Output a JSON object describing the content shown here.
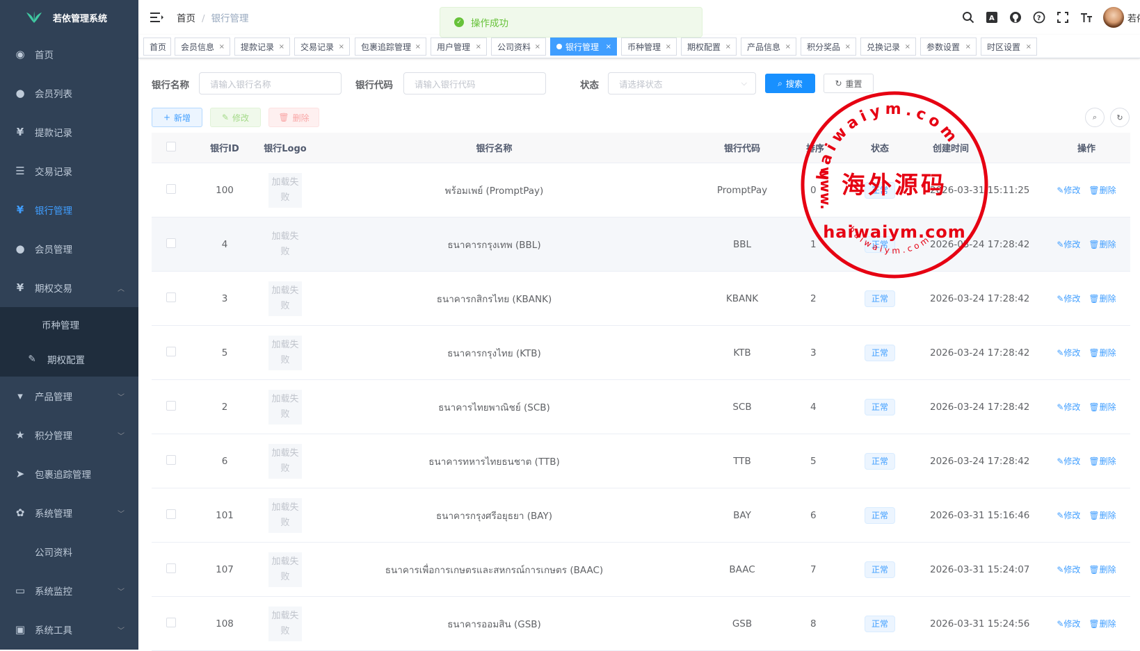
{
  "app": {
    "title": "若依管理系统"
  },
  "sidebar": {
    "items": [
      {
        "label": "首页",
        "icon": "dashboard-icon",
        "glyph": "◉"
      },
      {
        "label": "会员列表",
        "icon": "user-icon",
        "glyph": "●"
      },
      {
        "label": "提款记录",
        "icon": "yen-icon",
        "glyph": "¥"
      },
      {
        "label": "交易记录",
        "icon": "list-icon",
        "glyph": "☰"
      },
      {
        "label": "银行管理",
        "icon": "yen-icon",
        "glyph": "¥",
        "active": true
      },
      {
        "label": "会员管理",
        "icon": "peoples-icon",
        "glyph": "●"
      },
      {
        "label": "期权交易",
        "icon": "yen-icon",
        "glyph": "¥",
        "expanded": true
      }
    ],
    "sub_items": [
      {
        "label": "币种管理"
      },
      {
        "label": "期权配置",
        "icon": "edit-icon",
        "glyph": "✎"
      }
    ],
    "items2": [
      {
        "label": "产品管理",
        "icon": "cart-icon",
        "glyph": "▾"
      },
      {
        "label": "积分管理",
        "icon": "star-icon",
        "glyph": "★"
      },
      {
        "label": "包裹追踪管理",
        "icon": "send-icon",
        "glyph": "➤"
      },
      {
        "label": "系统管理",
        "icon": "gear-icon",
        "glyph": "✿"
      },
      {
        "label": "公司资料"
      },
      {
        "label": "系统监控",
        "icon": "monitor-icon",
        "glyph": "▭"
      },
      {
        "label": "系统工具",
        "icon": "tool-icon",
        "glyph": "▣"
      }
    ]
  },
  "breadcrumb": {
    "home": "首页",
    "sep": "/",
    "current": "银行管理"
  },
  "toast": {
    "message": "操作成功"
  },
  "navbar": {
    "username": "若依"
  },
  "tags": [
    "首页",
    "会员信息",
    "提款记录",
    "交易记录",
    "包裹追踪管理",
    "用户管理",
    "公司资料",
    "银行管理",
    "币种管理",
    "期权配置",
    "产品信息",
    "积分奖品",
    "兑换记录",
    "参数设置",
    "时区设置"
  ],
  "active_tag": "银行管理",
  "filters": {
    "name_label": "银行名称",
    "name_placeholder": "请输入银行名称",
    "code_label": "银行代码",
    "code_placeholder": "请输入银行代码",
    "status_label": "状态",
    "status_placeholder": "请选择状态",
    "search": "搜索",
    "reset": "重置"
  },
  "toolbar": {
    "add": "新增",
    "edit": "修改",
    "delete": "删除"
  },
  "table": {
    "headers": [
      "银行ID",
      "银行Logo",
      "银行名称",
      "银行代码",
      "排序",
      "状态",
      "创建时间",
      "操作"
    ],
    "logo_error": "加载失败",
    "edit": "修改",
    "delete": "删除",
    "rows": [
      {
        "id": "100",
        "name": "พร้อมเพย์ (PromptPay)",
        "code": "PromptPay",
        "sort": "0",
        "status": "正常",
        "time": "2026-03-31 15:11:25"
      },
      {
        "id": "4",
        "name": "ธนาคารกรุงเทพ (BBL)",
        "code": "BBL",
        "sort": "1",
        "status": "正常",
        "time": "2026-03-24 17:28:42"
      },
      {
        "id": "3",
        "name": "ธนาคารกสิกรไทย (KBANK)",
        "code": "KBANK",
        "sort": "2",
        "status": "正常",
        "time": "2026-03-24 17:28:42"
      },
      {
        "id": "5",
        "name": "ธนาคารกรุงไทย (KTB)",
        "code": "KTB",
        "sort": "3",
        "status": "正常",
        "time": "2026-03-24 17:28:42"
      },
      {
        "id": "2",
        "name": "ธนาคารไทยพาณิชย์ (SCB)",
        "code": "SCB",
        "sort": "4",
        "status": "正常",
        "time": "2026-03-24 17:28:42"
      },
      {
        "id": "6",
        "name": "ธนาคารทหารไทยธนชาต (TTB)",
        "code": "TTB",
        "sort": "5",
        "status": "正常",
        "time": "2026-03-24 17:28:42"
      },
      {
        "id": "101",
        "name": "ธนาคารกรุงศรีอยุธยา (BAY)",
        "code": "BAY",
        "sort": "6",
        "status": "正常",
        "time": "2026-03-31 15:16:46"
      },
      {
        "id": "107",
        "name": "ธนาคารเพื่อการเกษตรและสหกรณ์การเกษตร (BAAC)",
        "code": "BAAC",
        "sort": "7",
        "status": "正常",
        "time": "2026-03-31 15:24:07"
      },
      {
        "id": "108",
        "name": "ธนาคารออมสิน (GSB)",
        "code": "GSB",
        "sort": "8",
        "status": "正常",
        "time": "2026-03-31 15:24:56"
      }
    ]
  },
  "watermark": {
    "cn": "海外源码",
    "domain": "haiwaiym.com",
    "ring_top": "haiwaiym.com",
    "ring_left": "www.",
    "ring_bottom": "haiwaiym.com"
  },
  "colors": {
    "sidebar_bg": "#304156",
    "primary": "#409eff",
    "success": "#67c23a",
    "danger": "#f56c6c",
    "stamp": "#e60012"
  }
}
